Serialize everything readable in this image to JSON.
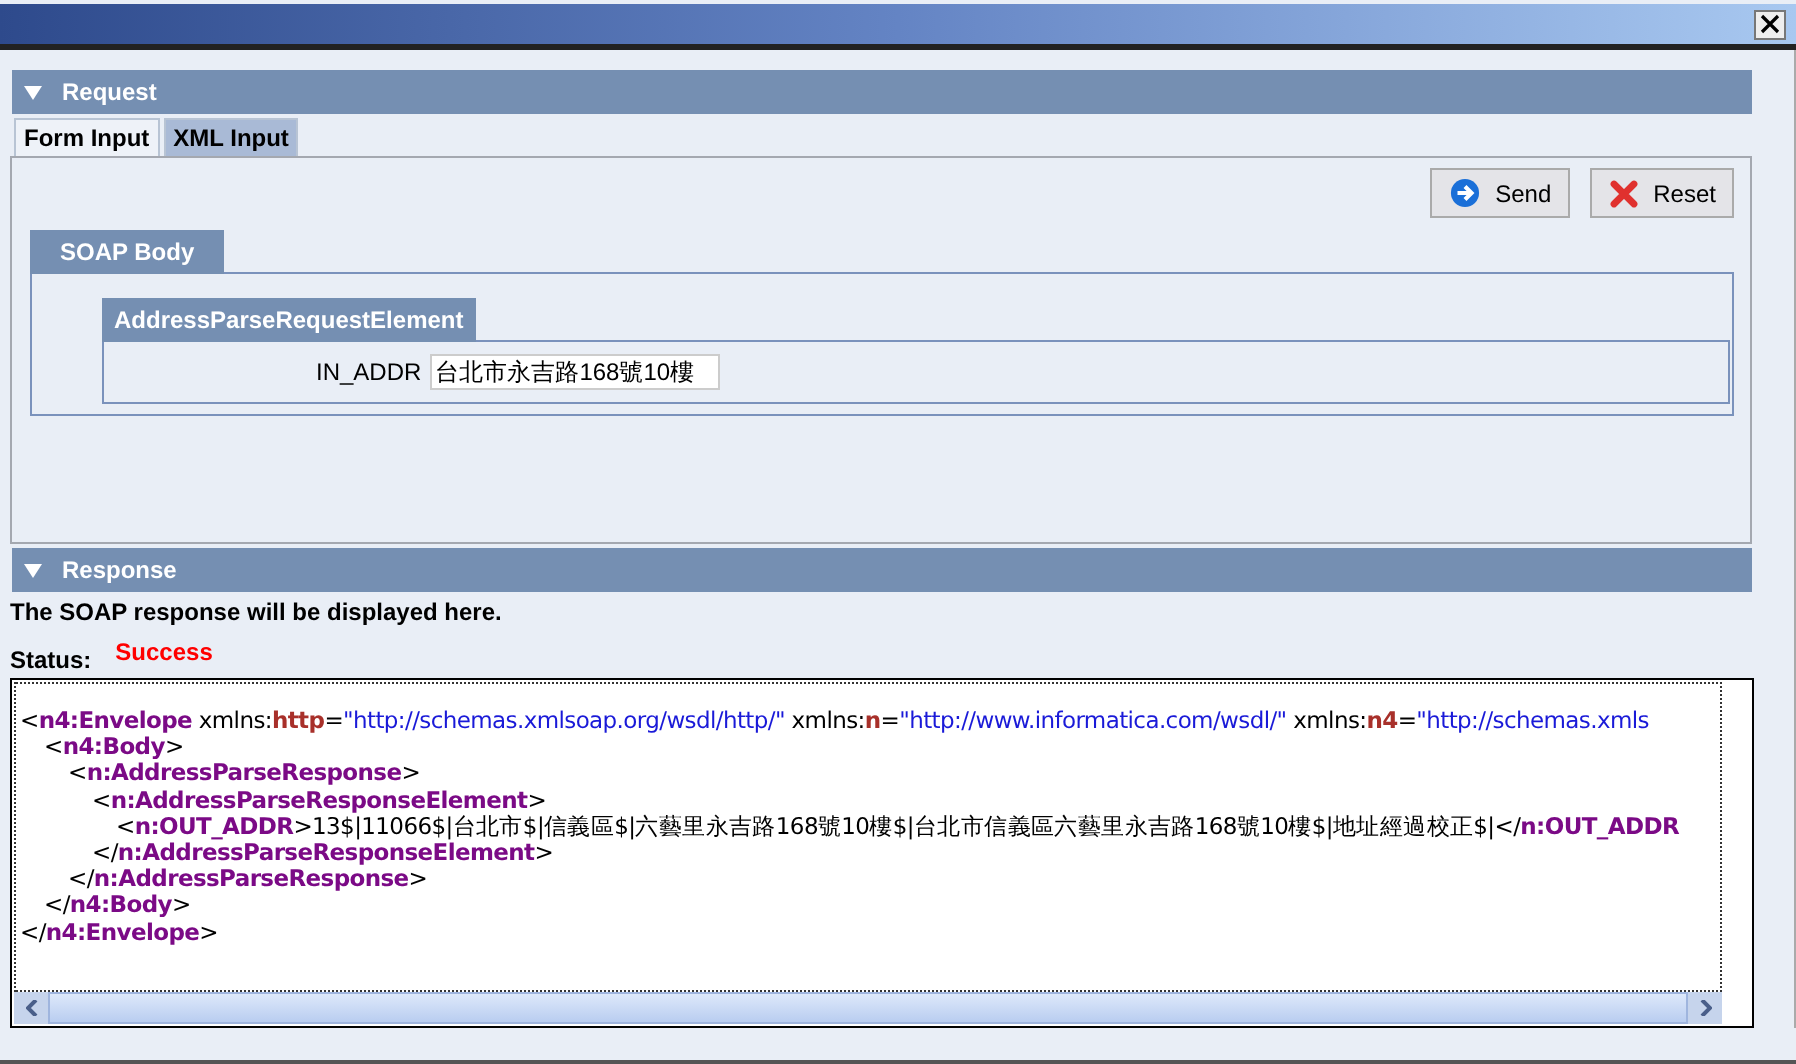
{
  "request": {
    "title": "Request",
    "expanded": true,
    "tabs": [
      {
        "label": "Form Input",
        "selected": true
      },
      {
        "label": "XML Input",
        "selected": false
      }
    ],
    "buttons": [
      {
        "label": "Send",
        "kind": "send"
      },
      {
        "label": "Reset",
        "kind": "reset"
      }
    ],
    "soap_body": {
      "title": "SOAP Body",
      "element": {
        "title": "AddressParseRequestElement",
        "fields": [
          {
            "label": "IN_ADDR",
            "value": "台北市永吉路168號10樓"
          }
        ]
      }
    }
  },
  "response": {
    "title": "Response",
    "expanded": true,
    "message": "The SOAP response will be displayed here.",
    "status_label": "Status:",
    "status": "Success",
    "xml": [
      {
        "open": [
          {
            "kind": "punct",
            "text": "<"
          },
          {
            "kind": "tag",
            "text": "n4:Envelope"
          },
          {
            "kind": "attr",
            "text": " xmlns:"
          },
          {
            "kind": "prefix",
            "text": "http"
          },
          {
            "kind": "punct",
            "text": "="
          },
          {
            "kind": "value",
            "text": "\"http://schemas.xmlsoap.org/wsdl/http/\""
          },
          {
            "kind": "attr",
            "text": " xmlns:"
          },
          {
            "kind": "prefix",
            "text": "n"
          },
          {
            "kind": "punct",
            "text": "="
          },
          {
            "kind": "value",
            "text": "\"http://www.informatica.com/wsdl/\""
          },
          {
            "kind": "attr",
            "text": " xmlns:"
          },
          {
            "kind": "prefix",
            "text": "n4"
          },
          {
            "kind": "punct",
            "text": "="
          },
          {
            "kind": "value",
            "text": "\"http://schemas.xmls"
          }
        ],
        "children": [
          {
            "open": [
              {
                "kind": "punct",
                "text": "<"
              },
              {
                "kind": "tag",
                "text": "n4:Body"
              },
              {
                "kind": "punct",
                "text": ">"
              }
            ],
            "children": [
              {
                "open": [
                  {
                    "kind": "punct",
                    "text": "<"
                  },
                  {
                    "kind": "tag",
                    "text": "n:AddressParseResponse"
                  },
                  {
                    "kind": "punct",
                    "text": ">"
                  }
                ],
                "children": [
                  {
                    "open": [
                      {
                        "kind": "punct",
                        "text": "<"
                      },
                      {
                        "kind": "tag",
                        "text": "n:AddressParseResponseElement"
                      },
                      {
                        "kind": "punct",
                        "text": ">"
                      }
                    ],
                    "children": [
                      {
                        "tokens": [
                          {
                            "kind": "punct",
                            "text": "<"
                          },
                          {
                            "kind": "tag",
                            "text": "n:OUT_ADDR"
                          },
                          {
                            "kind": "text",
                            "text": ">13$|11066$|台北市$|信義區$|六藝里永吉路168號10樓$|台北市信義區六藝里永吉路168號10樓$|地址經過校正$|</"
                          },
                          {
                            "kind": "tag",
                            "text": "n:OUT_ADDR"
                          }
                        ]
                      }
                    ],
                    "close": [
                      {
                        "kind": "punct",
                        "text": "</"
                      },
                      {
                        "kind": "tag",
                        "text": "n:AddressParseResponseElement"
                      },
                      {
                        "kind": "punct",
                        "text": ">"
                      }
                    ]
                  }
                ],
                "close": [
                  {
                    "kind": "punct",
                    "text": "</"
                  },
                  {
                    "kind": "tag",
                    "text": "n:AddressParseResponse"
                  },
                  {
                    "kind": "punct",
                    "text": ">"
                  }
                ]
              }
            ],
            "close": [
              {
                "kind": "punct",
                "text": "</"
              },
              {
                "kind": "tag",
                "text": "n4:Body"
              },
              {
                "kind": "punct",
                "text": ">"
              }
            ]
          }
        ],
        "close": [
          {
            "kind": "punct",
            "text": "</"
          },
          {
            "kind": "tag",
            "text": "n4:Envelope"
          },
          {
            "kind": "punct",
            "text": ">"
          }
        ]
      }
    ]
  }
}
